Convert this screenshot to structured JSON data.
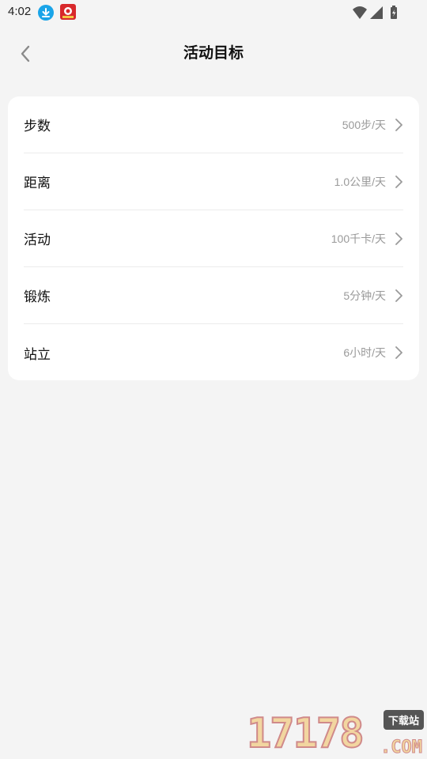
{
  "status_bar": {
    "time": "4:02",
    "icons": [
      "download-icon",
      "app-notification-icon",
      "wifi-icon",
      "signal-icon",
      "battery-icon"
    ]
  },
  "header": {
    "title": "活动目标",
    "back_icon": "chevron-left-icon"
  },
  "goals": {
    "items": [
      {
        "label": "步数",
        "value": "500步/天"
      },
      {
        "label": "距离",
        "value": "1.0公里/天"
      },
      {
        "label": "活动",
        "value": "100千卡/天"
      },
      {
        "label": "锻炼",
        "value": "5分钟/天"
      },
      {
        "label": "站立",
        "value": "6小时/天"
      }
    ]
  },
  "watermark": {
    "digits": "17178",
    "badge": "下载站",
    "suffix": ".COM"
  },
  "colors": {
    "background": "#f4f4f4",
    "card": "#ffffff",
    "value_text": "#9a9a9a",
    "chevron": "#9a9a9a"
  }
}
